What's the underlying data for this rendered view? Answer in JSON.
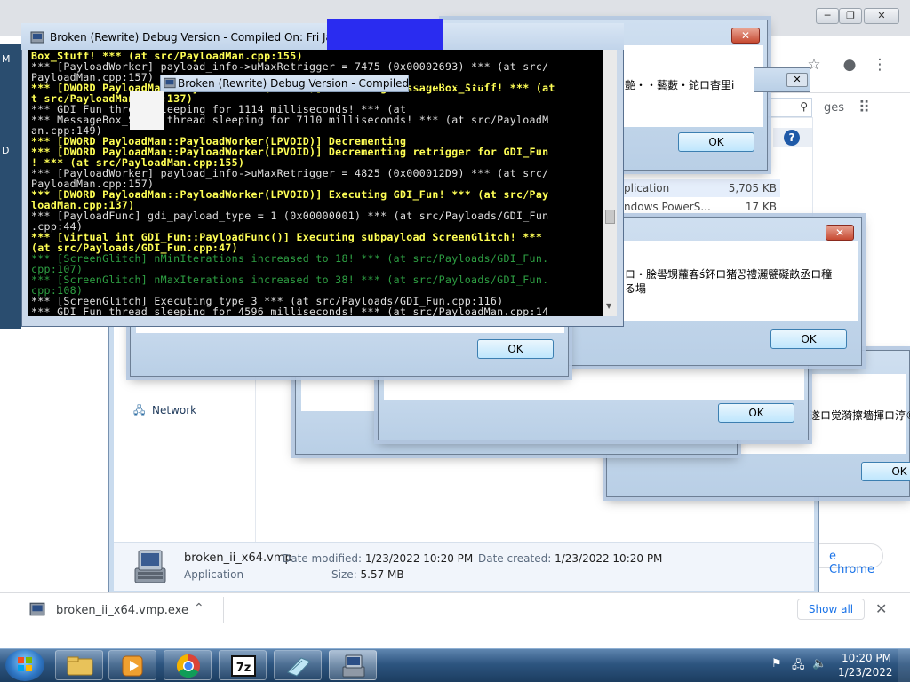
{
  "chrome": {
    "side_text": "ges",
    "open_chrome_link": "e Chrome"
  },
  "explorer": {
    "nav_network": "Network",
    "list_rows": [
      {
        "name": "plication",
        "size": "5,705 KB"
      },
      {
        "name": "ndows PowerS...",
        "size": "17 KB"
      }
    ],
    "details": {
      "file_name": "broken_ii_x64.vmp",
      "file_type": "Application",
      "date_modified_label": "Date modified:",
      "date_modified": "1/23/2022 10:20 PM",
      "date_created_label": "Date created:",
      "date_created": "1/23/2022 10:20 PM",
      "size_label": "Size:",
      "size": "5.57 MB"
    }
  },
  "console": {
    "title": "Broken (Rewrite) Debug Version - Compiled On: Fri Jan 21 2",
    "nested_title": "Broken (Rewrite) Debug Version - Compiled On: Fri Jan 21 2",
    "lines": [
      {
        "t": "Box_Stuff! *** (at src/PayloadMan.cpp:155)",
        "c": "y"
      },
      {
        "t": "*** [PayloadWorker] payload_info->uMaxRetrigger = 7475 (0x00002693) *** (at src/",
        "c": "w"
      },
      {
        "t": "PayloadMan.cpp:157)",
        "c": "w"
      },
      {
        "t": "*** [DWORD PayloadMan::PayloadWorker(LPVOID)] Executing MessageBox_Stuff! *** (at",
        "c": "y"
      },
      {
        "t": "t src/PayloadMan.cpp:137)",
        "c": "y"
      },
      {
        "t": "*** GDI_Fun thread sleeping for 1114 milliseconds! *** (at",
        "c": "w"
      },
      {
        "t": "*** MessageBox_Stuff thread sleeping for 7110 milliseconds! *** (at src/PayloadM",
        "c": "w"
      },
      {
        "t": "an.cpp:149)",
        "c": "w"
      },
      {
        "t": "*** [DWORD PayloadMan::PayloadWorker(LPVOID)] Decrementing",
        "c": "y"
      },
      {
        "t": "*** [DWORD PayloadMan::PayloadWorker(LPVOID)] Decrementing retrigger for GDI_Fun",
        "c": "y"
      },
      {
        "t": "! *** (at src/PayloadMan.cpp:155)",
        "c": "y"
      },
      {
        "t": "*** [PayloadWorker] payload_info->uMaxRetrigger = 4825 (0x000012D9) *** (at src/",
        "c": "w"
      },
      {
        "t": "PayloadMan.cpp:157)",
        "c": "w"
      },
      {
        "t": "*** [DWORD PayloadMan::PayloadWorker(LPVOID)] Executing GDI_Fun! *** (at src/Pay",
        "c": "y"
      },
      {
        "t": "loadMan.cpp:137)",
        "c": "y"
      },
      {
        "t": "*** [PayloadFunc] gdi_payload_type = 1 (0x00000001) *** (at src/Payloads/GDI_Fun",
        "c": "w"
      },
      {
        "t": ".cpp:44)",
        "c": "w"
      },
      {
        "t": "*** [virtual int GDI_Fun::PayloadFunc()] Executing subpayload ScreenGlitch! ***",
        "c": "y"
      },
      {
        "t": "(at src/Payloads/GDI_Fun.cpp:47)",
        "c": "y"
      },
      {
        "t": "*** [ScreenGlitch] nMinIterations increased to 18! *** (at src/Payloads/GDI_Fun.",
        "c": "g"
      },
      {
        "t": "cpp:107)",
        "c": "g"
      },
      {
        "t": "*** [ScreenGlitch] nMaxIterations increased to 38! *** (at src/Payloads/GDI_Fun.",
        "c": "g"
      },
      {
        "t": "cpp:108)",
        "c": "g"
      },
      {
        "t": "*** [ScreenGlitch] Executing type 3 *** (at src/Payloads/GDI_Fun.cpp:116)",
        "c": "w"
      },
      {
        "t": "*** GDI_Fun thread sleeping for 4596 milliseconds! *** (at src/PayloadMan.cpp:14",
        "c": "w"
      },
      {
        "t": "9)",
        "c": "w"
      }
    ]
  },
  "message_boxes": {
    "box_top": {
      "text": "艶・・藝藪・鉈ロ杳里i",
      "ok": "OK",
      "close": "✕"
    },
    "box_mid": {
      "text": "ロ・脍嚳甥蘿客ś鈈ロ猪꽁禮灑甓礙畝丞ロ穜",
      "text2": "る塌",
      "ok": "OK",
      "close": "✕"
    },
    "box_left": {
      "ok": "OK"
    },
    "box_center": {
      "ok": "OK"
    },
    "box_right": {
      "text": "遂ロ觉漪擦墻揮ロ涥®",
      "ok": "OK"
    }
  },
  "downloads": {
    "file": "broken_ii_x64.vmp.exe",
    "show_all": "Show all"
  },
  "taskbar": {
    "time": "10:20 PM",
    "date": "1/23/2022"
  },
  "colors": {
    "accent": "#1a73e8",
    "console_bg": "#000000",
    "console_yellow": "#ffff55",
    "console_green": "#2ea043"
  }
}
